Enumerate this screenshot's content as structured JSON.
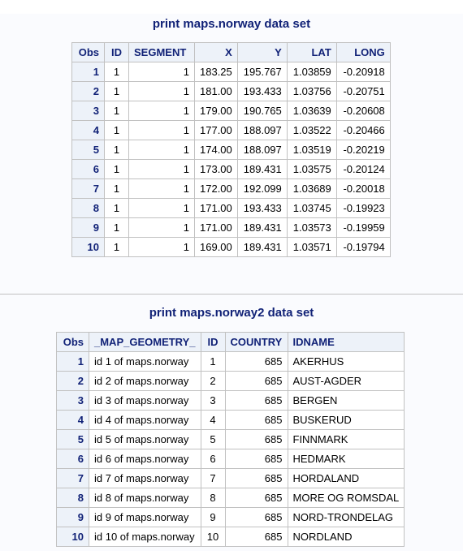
{
  "table1": {
    "title": "print maps.norway data set",
    "headers": [
      "Obs",
      "ID",
      "SEGMENT",
      "X",
      "Y",
      "LAT",
      "LONG"
    ],
    "rows": [
      [
        "1",
        "1",
        "1",
        "183.25",
        "195.767",
        "1.03859",
        "-0.20918"
      ],
      [
        "2",
        "1",
        "1",
        "181.00",
        "193.433",
        "1.03756",
        "-0.20751"
      ],
      [
        "3",
        "1",
        "1",
        "179.00",
        "190.765",
        "1.03639",
        "-0.20608"
      ],
      [
        "4",
        "1",
        "1",
        "177.00",
        "188.097",
        "1.03522",
        "-0.20466"
      ],
      [
        "5",
        "1",
        "1",
        "174.00",
        "188.097",
        "1.03519",
        "-0.20219"
      ],
      [
        "6",
        "1",
        "1",
        "173.00",
        "189.431",
        "1.03575",
        "-0.20124"
      ],
      [
        "7",
        "1",
        "1",
        "172.00",
        "192.099",
        "1.03689",
        "-0.20018"
      ],
      [
        "8",
        "1",
        "1",
        "171.00",
        "193.433",
        "1.03745",
        "-0.19923"
      ],
      [
        "9",
        "1",
        "1",
        "171.00",
        "189.431",
        "1.03573",
        "-0.19959"
      ],
      [
        "10",
        "1",
        "1",
        "169.00",
        "189.431",
        "1.03571",
        "-0.19794"
      ]
    ]
  },
  "table2": {
    "title": "print maps.norway2 data set",
    "headers": [
      "Obs",
      "_MAP_GEOMETRY_",
      "ID",
      "COUNTRY",
      "IDNAME"
    ],
    "rows": [
      [
        "1",
        "id 1 of maps.norway",
        "1",
        "685",
        "AKERHUS"
      ],
      [
        "2",
        "id 2 of maps.norway",
        "2",
        "685",
        "AUST-AGDER"
      ],
      [
        "3",
        "id 3 of maps.norway",
        "3",
        "685",
        "BERGEN"
      ],
      [
        "4",
        "id 4 of maps.norway",
        "4",
        "685",
        "BUSKERUD"
      ],
      [
        "5",
        "id 5 of maps.norway",
        "5",
        "685",
        "FINNMARK"
      ],
      [
        "6",
        "id 6 of maps.norway",
        "6",
        "685",
        "HEDMARK"
      ],
      [
        "7",
        "id 7 of maps.norway",
        "7",
        "685",
        "HORDALAND"
      ],
      [
        "8",
        "id 8 of maps.norway",
        "8",
        "685",
        "MORE OG ROMSDAL"
      ],
      [
        "9",
        "id 9 of maps.norway",
        "9",
        "685",
        "NORD-TRONDELAG"
      ],
      [
        "10",
        "id 10 of maps.norway",
        "10",
        "685",
        "NORDLAND"
      ]
    ]
  },
  "colors": {
    "header_bg": "#edf2f9",
    "header_text": "#112277",
    "border": "#c1c1c1",
    "page_bg": "#fafbfe"
  }
}
